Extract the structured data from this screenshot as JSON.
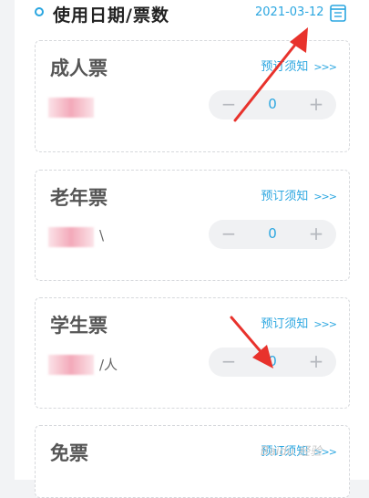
{
  "header": {
    "title": "使用日期/票数",
    "date": "2021-03-12"
  },
  "tickets": [
    {
      "name": "成人票",
      "notice": "预订须知",
      "chevrons": ">>>",
      "unit": "",
      "quantity": "0",
      "minus": "−",
      "plus": "+"
    },
    {
      "name": "老年票",
      "notice": "预订须知",
      "chevrons": ">>>",
      "unit": "\\",
      "quantity": "0",
      "minus": "−",
      "plus": "+"
    },
    {
      "name": "学生票",
      "notice": "预订须知",
      "chevrons": ">>>",
      "unit": "/人",
      "quantity": "0",
      "minus": "−",
      "plus": "+"
    },
    {
      "name": "免票",
      "notice": "预订须知",
      "chevrons": ">>>"
    }
  ],
  "watermark": "Baidu 经验",
  "colors": {
    "accent": "#2aa6e0",
    "annotation_arrow": "#e8322c"
  }
}
